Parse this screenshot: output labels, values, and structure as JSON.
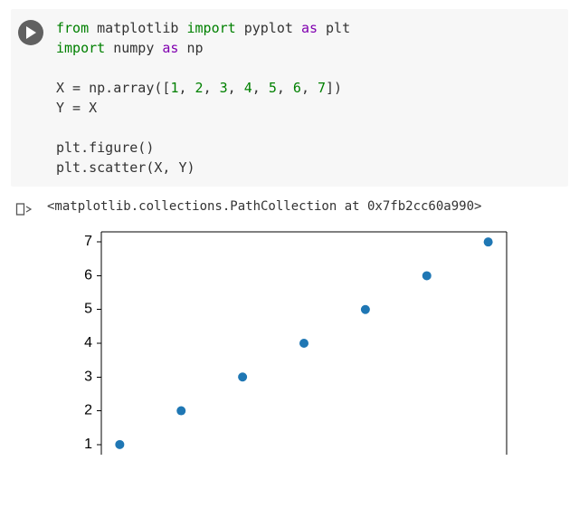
{
  "code": {
    "lines": [
      {
        "t": "import",
        "tokens": [
          [
            "kw-imp",
            "from"
          ],
          [
            "sp",
            " "
          ],
          [
            "name",
            "matplotlib"
          ],
          [
            "sp",
            " "
          ],
          [
            "kw-imp",
            "import"
          ],
          [
            "sp",
            " "
          ],
          [
            "name",
            "pyplot"
          ],
          [
            "sp",
            " "
          ],
          [
            "kw-as",
            "as"
          ],
          [
            "sp",
            " "
          ],
          [
            "name",
            "plt"
          ]
        ]
      },
      {
        "t": "import",
        "tokens": [
          [
            "kw-imp",
            "import"
          ],
          [
            "sp",
            " "
          ],
          [
            "name",
            "numpy"
          ],
          [
            "sp",
            " "
          ],
          [
            "kw-as",
            "as"
          ],
          [
            "sp",
            " "
          ],
          [
            "name",
            "np"
          ]
        ]
      },
      {
        "t": "blank",
        "text": ""
      },
      {
        "t": "assign",
        "tokens": [
          [
            "name",
            "X = np.array(["
          ],
          [
            "num",
            "1"
          ],
          [
            "punct",
            ", "
          ],
          [
            "num",
            "2"
          ],
          [
            "punct",
            ", "
          ],
          [
            "num",
            "3"
          ],
          [
            "punct",
            ", "
          ],
          [
            "num",
            "4"
          ],
          [
            "punct",
            ", "
          ],
          [
            "num",
            "5"
          ],
          [
            "punct",
            ", "
          ],
          [
            "num",
            "6"
          ],
          [
            "punct",
            ", "
          ],
          [
            "num",
            "7"
          ],
          [
            "punct",
            "])"
          ]
        ]
      },
      {
        "t": "assign",
        "tokens": [
          [
            "name",
            "Y = X"
          ]
        ]
      },
      {
        "t": "blank",
        "text": ""
      },
      {
        "t": "call",
        "tokens": [
          [
            "name",
            "plt.figure()"
          ]
        ]
      },
      {
        "t": "call",
        "tokens": [
          [
            "name",
            "plt.scatter(X, Y)"
          ]
        ]
      }
    ]
  },
  "output": {
    "repr": "<matplotlib.collections.PathCollection at 0x7fb2cc60a990>"
  },
  "chart_data": {
    "type": "scatter",
    "x": [
      1,
      2,
      3,
      4,
      5,
      6,
      7
    ],
    "y": [
      1,
      2,
      3,
      4,
      5,
      6,
      7
    ],
    "xlabel": "",
    "ylabel": "",
    "title": "",
    "y_ticks": [
      1,
      2,
      3,
      4,
      5,
      6,
      7
    ],
    "xlim": [
      0.7,
      7.3
    ],
    "ylim": [
      0.7,
      7.3
    ],
    "marker_color": "#1f77b4"
  }
}
